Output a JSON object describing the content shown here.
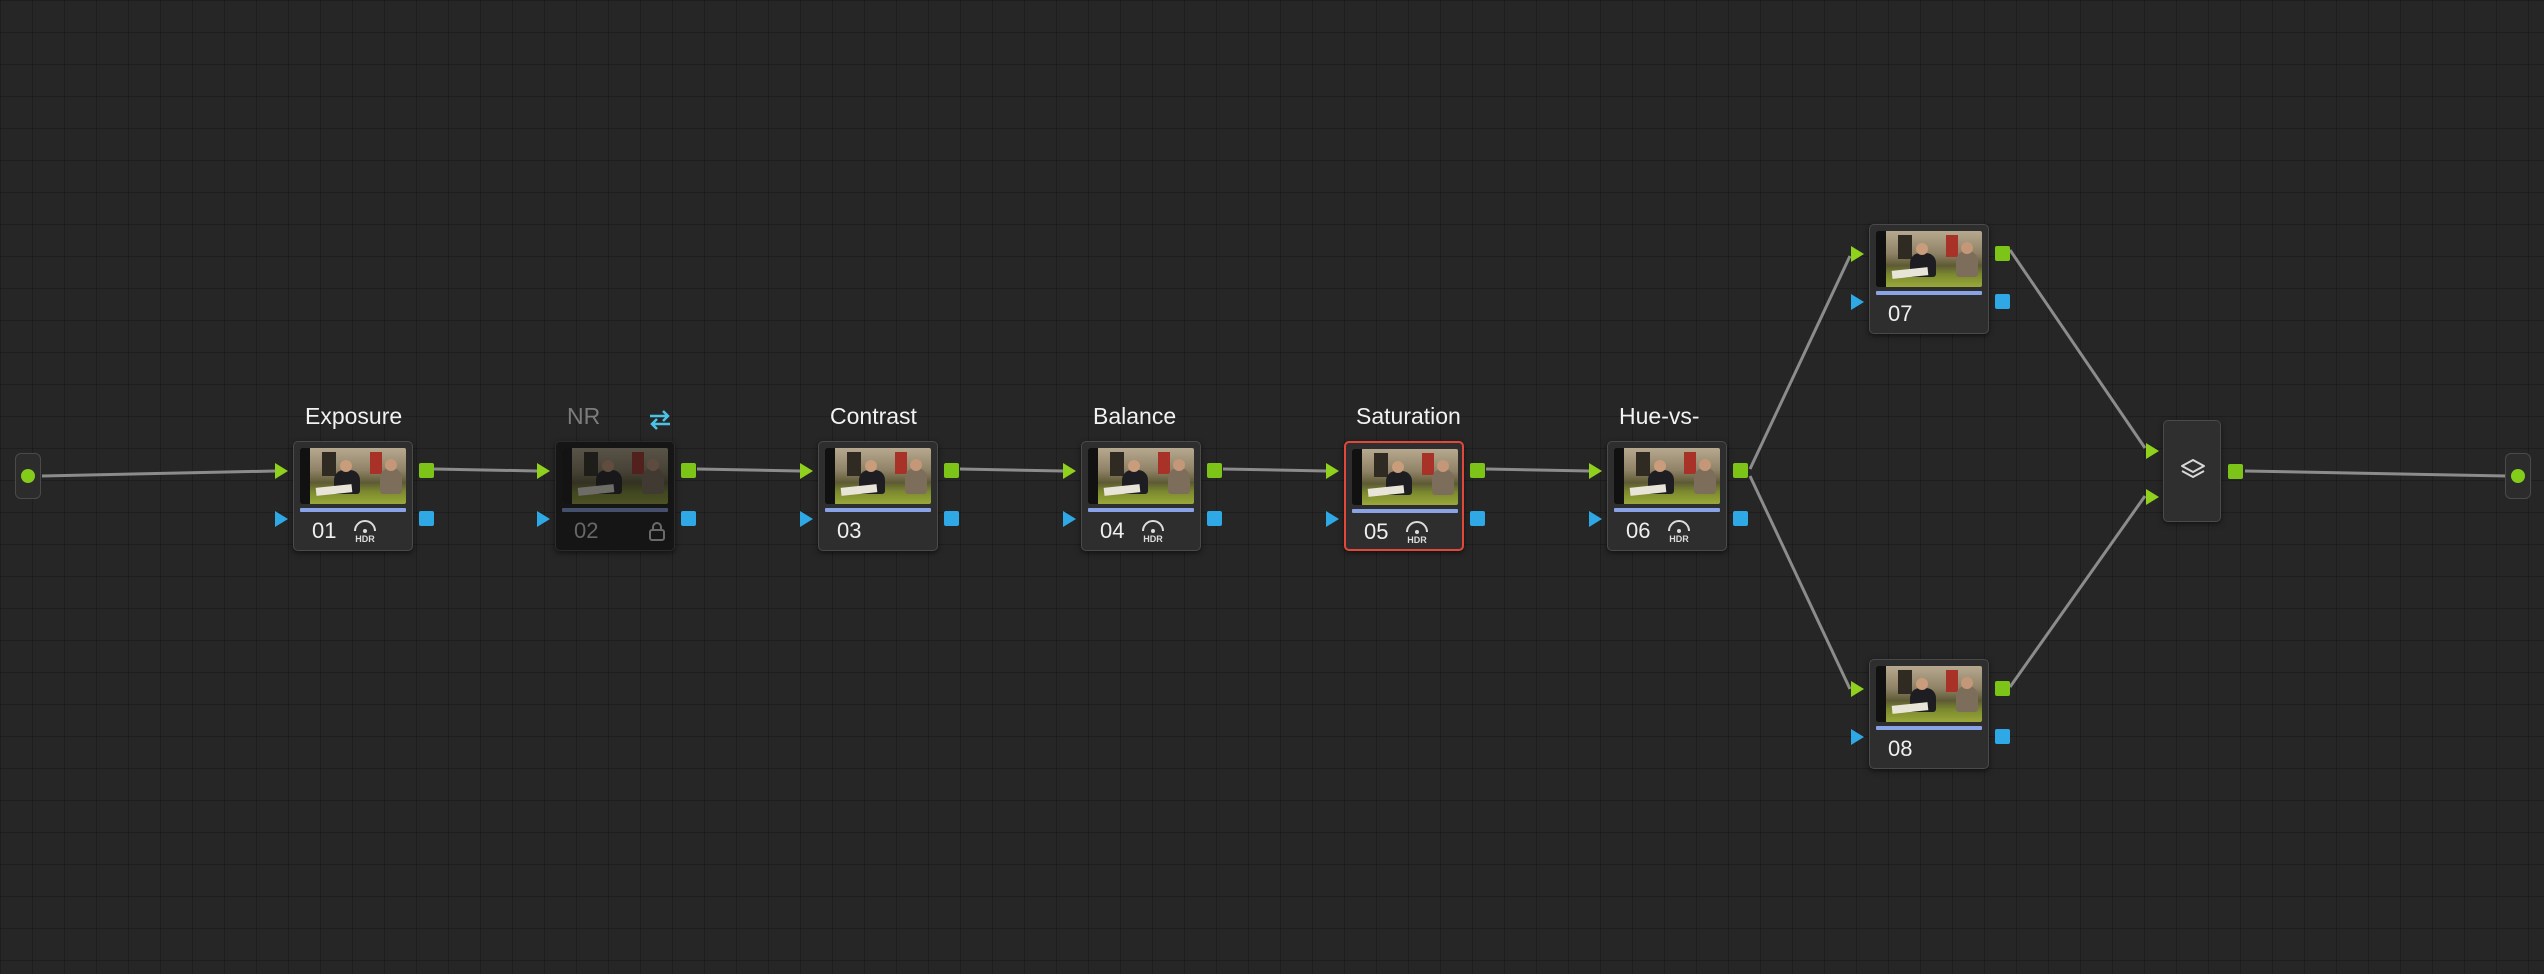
{
  "nodes": [
    {
      "number": "01",
      "title": "Exposure",
      "hdr": true,
      "selected": false,
      "disabled": false
    },
    {
      "number": "02",
      "title": "NR",
      "hdr": false,
      "selected": false,
      "disabled": true,
      "locked": true,
      "swap": true
    },
    {
      "number": "03",
      "title": "Contrast",
      "hdr": false,
      "selected": false,
      "disabled": false
    },
    {
      "number": "04",
      "title": "Balance",
      "hdr": true,
      "selected": false,
      "disabled": false
    },
    {
      "number": "05",
      "title": "Saturation",
      "hdr": true,
      "selected": true,
      "disabled": false
    },
    {
      "number": "06",
      "title": "Hue-vs-",
      "hdr": true,
      "selected": false,
      "disabled": false
    },
    {
      "number": "07",
      "title": "",
      "hdr": false,
      "selected": false,
      "disabled": false
    },
    {
      "number": "08",
      "title": "",
      "hdr": false,
      "selected": false,
      "disabled": false
    }
  ],
  "hdr_icon_label": "HDR",
  "layer_mixer": {
    "icon": "layers-icon"
  },
  "colors": {
    "rgb_port": "#8fd11d",
    "alpha_port": "#2fa8e6",
    "selected_outline": "#e2483a",
    "wire": "#8c8c8c"
  }
}
